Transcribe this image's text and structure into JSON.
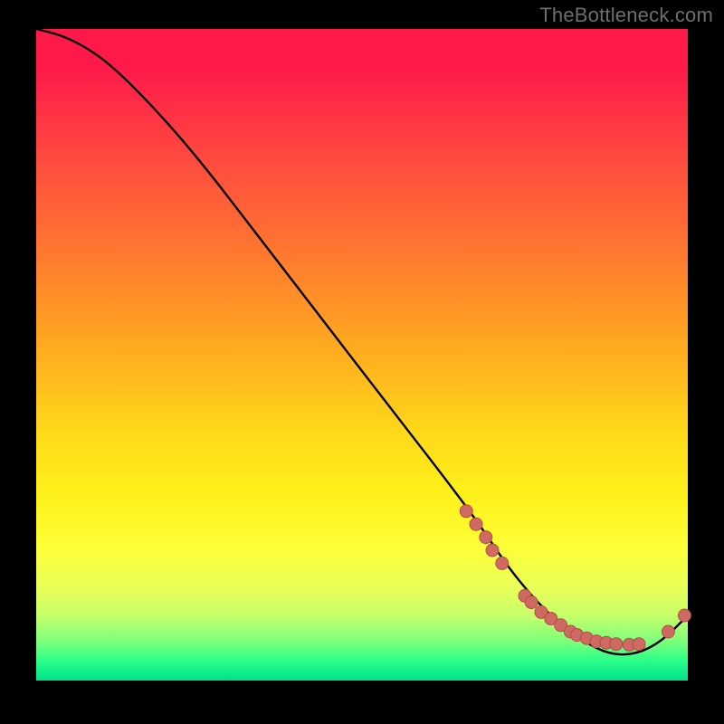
{
  "watermark": "TheBottleneck.com",
  "colors": {
    "background": "#000000",
    "curve": "#000000",
    "marker_fill": "#cf6a63",
    "marker_stroke": "#b44d47",
    "gradient_top": "#ff1a4a",
    "gradient_bottom": "#00e08a",
    "text": "#6e6e6e"
  },
  "chart_data": {
    "type": "line",
    "title": "",
    "xlabel": "",
    "ylabel": "",
    "xlim": [
      0,
      100
    ],
    "ylim": [
      0,
      100
    ],
    "grid": false,
    "legend": false,
    "series": [
      {
        "name": "curve",
        "x": [
          0,
          4,
          8,
          12,
          18,
          25,
          35,
          45,
          55,
          62,
          68,
          72,
          76,
          80,
          84,
          88,
          92,
          96,
          100
        ],
        "y": [
          100,
          99,
          97,
          94,
          88,
          80,
          67,
          54,
          41,
          32,
          24,
          18,
          13,
          9,
          6,
          4,
          4,
          6,
          10
        ]
      }
    ],
    "markers": {
      "comment": "dense marker cluster along the descending limb near the bottom and the trough/up-tick",
      "x": [
        66,
        67.5,
        69,
        70,
        71.5,
        75,
        76,
        77.5,
        79,
        80.5,
        82,
        83,
        84.5,
        86,
        87.5,
        89,
        91,
        92.5,
        97,
        99.5
      ],
      "y": [
        26,
        24,
        22,
        20,
        18,
        13,
        12,
        10.5,
        9.5,
        8.5,
        7.5,
        7,
        6.5,
        6,
        5.8,
        5.6,
        5.5,
        5.6,
        7.5,
        10
      ]
    }
  }
}
